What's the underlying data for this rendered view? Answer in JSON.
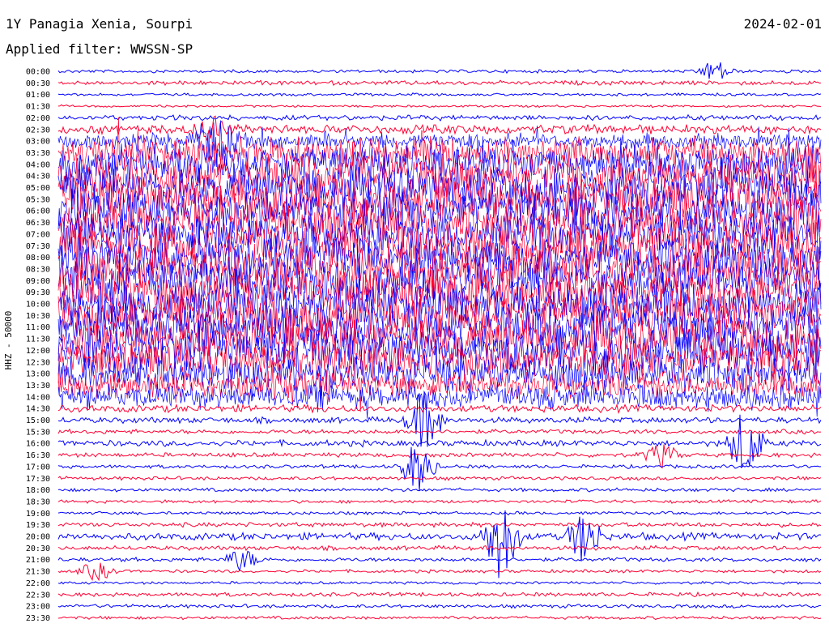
{
  "header": {
    "station": "1Y Panagia Xenia, Sourpi",
    "date": "2024-02-01",
    "filter": "Applied filter: WWSSN-SP"
  },
  "colors": {
    "trace_a": "#0000ff",
    "trace_b": "#ff0033",
    "text": "#000000"
  },
  "chart_data": {
    "type": "line",
    "title": "1Y Panagia Xenia, Sourpi",
    "ylabel": "HHZ - 50000",
    "xlabel": "",
    "grid": false,
    "legend": "none",
    "rows": [
      {
        "time": "00:00",
        "activity": 0.05,
        "color": "blue"
      },
      {
        "time": "00:30",
        "activity": 0.08,
        "color": "red"
      },
      {
        "time": "01:00",
        "activity": 0.04,
        "color": "blue"
      },
      {
        "time": "01:30",
        "activity": 0.03,
        "color": "red"
      },
      {
        "time": "02:00",
        "activity": 0.1,
        "color": "blue"
      },
      {
        "time": "02:30",
        "activity": 0.2,
        "color": "red"
      },
      {
        "time": "03:00",
        "activity": 0.35,
        "color": "blue"
      },
      {
        "time": "03:30",
        "activity": 0.7,
        "color": "red"
      },
      {
        "time": "04:00",
        "activity": 0.85,
        "color": "blue"
      },
      {
        "time": "04:30",
        "activity": 0.95,
        "color": "red"
      },
      {
        "time": "05:00",
        "activity": 1.0,
        "color": "blue"
      },
      {
        "time": "05:30",
        "activity": 1.0,
        "color": "red"
      },
      {
        "time": "06:00",
        "activity": 1.0,
        "color": "blue"
      },
      {
        "time": "06:30",
        "activity": 1.0,
        "color": "red"
      },
      {
        "time": "07:00",
        "activity": 1.0,
        "color": "blue"
      },
      {
        "time": "07:30",
        "activity": 1.0,
        "color": "red"
      },
      {
        "time": "08:00",
        "activity": 1.0,
        "color": "blue"
      },
      {
        "time": "08:30",
        "activity": 1.0,
        "color": "red"
      },
      {
        "time": "09:00",
        "activity": 1.0,
        "color": "blue"
      },
      {
        "time": "09:30",
        "activity": 1.0,
        "color": "red"
      },
      {
        "time": "10:00",
        "activity": 1.0,
        "color": "blue"
      },
      {
        "time": "10:30",
        "activity": 1.0,
        "color": "red"
      },
      {
        "time": "11:00",
        "activity": 1.0,
        "color": "blue"
      },
      {
        "time": "11:30",
        "activity": 1.0,
        "color": "red"
      },
      {
        "time": "12:00",
        "activity": 1.0,
        "color": "blue"
      },
      {
        "time": "12:30",
        "activity": 0.9,
        "color": "red"
      },
      {
        "time": "13:00",
        "activity": 0.8,
        "color": "blue"
      },
      {
        "time": "13:30",
        "activity": 0.6,
        "color": "red"
      },
      {
        "time": "14:00",
        "activity": 0.55,
        "color": "blue"
      },
      {
        "time": "14:30",
        "activity": 0.15,
        "color": "red"
      },
      {
        "time": "15:00",
        "activity": 0.12,
        "color": "blue"
      },
      {
        "time": "15:30",
        "activity": 0.08,
        "color": "red"
      },
      {
        "time": "16:00",
        "activity": 0.12,
        "color": "blue"
      },
      {
        "time": "16:30",
        "activity": 0.08,
        "color": "red"
      },
      {
        "time": "17:00",
        "activity": 0.06,
        "color": "blue"
      },
      {
        "time": "17:30",
        "activity": 0.06,
        "color": "red"
      },
      {
        "time": "18:00",
        "activity": 0.06,
        "color": "blue"
      },
      {
        "time": "18:30",
        "activity": 0.05,
        "color": "red"
      },
      {
        "time": "19:00",
        "activity": 0.05,
        "color": "blue"
      },
      {
        "time": "19:30",
        "activity": 0.08,
        "color": "red"
      },
      {
        "time": "20:00",
        "activity": 0.15,
        "color": "blue"
      },
      {
        "time": "20:30",
        "activity": 0.08,
        "color": "red"
      },
      {
        "time": "21:00",
        "activity": 0.07,
        "color": "blue"
      },
      {
        "time": "21:30",
        "activity": 0.05,
        "color": "red"
      },
      {
        "time": "22:00",
        "activity": 0.04,
        "color": "blue"
      },
      {
        "time": "22:30",
        "activity": 0.07,
        "color": "red"
      },
      {
        "time": "23:00",
        "activity": 0.06,
        "color": "blue"
      },
      {
        "time": "23:30",
        "activity": 0.05,
        "color": "red"
      }
    ],
    "events": [
      {
        "time": "00:00",
        "pos": 0.86,
        "amp": 0.5
      },
      {
        "time": "02:30",
        "pos": 0.2,
        "amp": 0.6
      },
      {
        "time": "03:00",
        "pos": 0.21,
        "amp": 0.9
      },
      {
        "time": "15:00",
        "pos": 0.48,
        "amp": 1.4
      },
      {
        "time": "16:00",
        "pos": 0.9,
        "amp": 1.6
      },
      {
        "time": "16:30",
        "pos": 0.79,
        "amp": 0.5
      },
      {
        "time": "17:00",
        "pos": 0.47,
        "amp": 1.2
      },
      {
        "time": "20:00",
        "pos": 0.58,
        "amp": 2.0
      },
      {
        "time": "20:00",
        "pos": 0.69,
        "amp": 1.2
      },
      {
        "time": "21:00",
        "pos": 0.24,
        "amp": 0.5
      },
      {
        "time": "21:30",
        "pos": 0.05,
        "amp": 0.4
      }
    ]
  }
}
